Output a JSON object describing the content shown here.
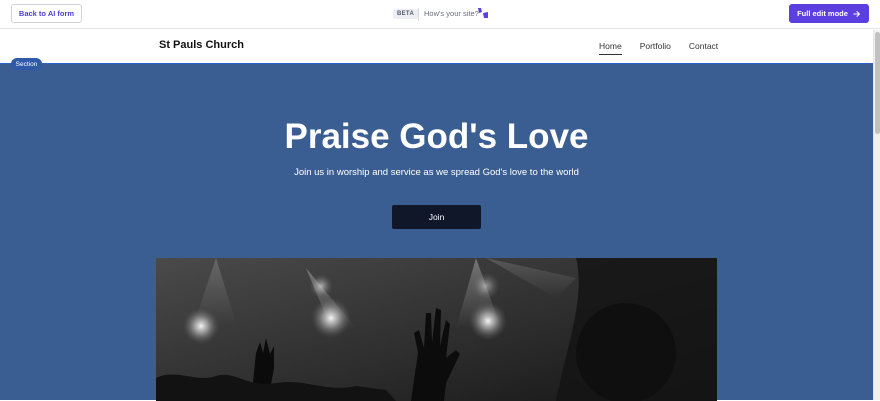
{
  "editor_bar": {
    "back_label": "Back to AI form",
    "beta_label": "BETA",
    "feedback_label": "How's your site?",
    "full_edit_label": "Full edit mode",
    "accent": "#5b3fe0"
  },
  "site": {
    "title": "St Pauls Church",
    "nav": [
      "Home",
      "Portfolio",
      "Contact"
    ],
    "active_nav": "Home"
  },
  "section_tag": "Section",
  "hero": {
    "title": "Praise God's Love",
    "subtitle": "Join us in worship and service as we spread God's love to the world",
    "cta_label": "Join",
    "background": "#3a5e92",
    "image_description_icon": "concert-photo"
  }
}
